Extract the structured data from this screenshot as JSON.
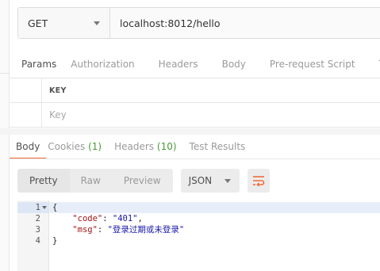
{
  "request": {
    "method": "GET",
    "url": "localhost:8012/hello"
  },
  "request_tabs": [
    "Params",
    "Authorization",
    "Headers",
    "Body",
    "Pre-request Script",
    "Te"
  ],
  "params": {
    "key_header": "KEY",
    "key_placeholder": "Key"
  },
  "response_tabs": {
    "body": "Body",
    "cookies": "Cookies",
    "cookies_count": "(1)",
    "headers": "Headers",
    "headers_count": "(10)",
    "tests": "Test Results"
  },
  "toolbar": {
    "pretty": "Pretty",
    "raw": "Raw",
    "preview": "Preview",
    "format": "JSON"
  },
  "response_body": {
    "line_numbers": [
      "1",
      "2",
      "3",
      "4"
    ],
    "open": "{",
    "close": "}",
    "code_key": "\"code\"",
    "code_value": "\"401\"",
    "msg_key": "\"msg\"",
    "msg_value": "\"登录过期或未登录\""
  },
  "colors": {
    "accent": "#f26b3a",
    "count": "#4a9a3b"
  }
}
